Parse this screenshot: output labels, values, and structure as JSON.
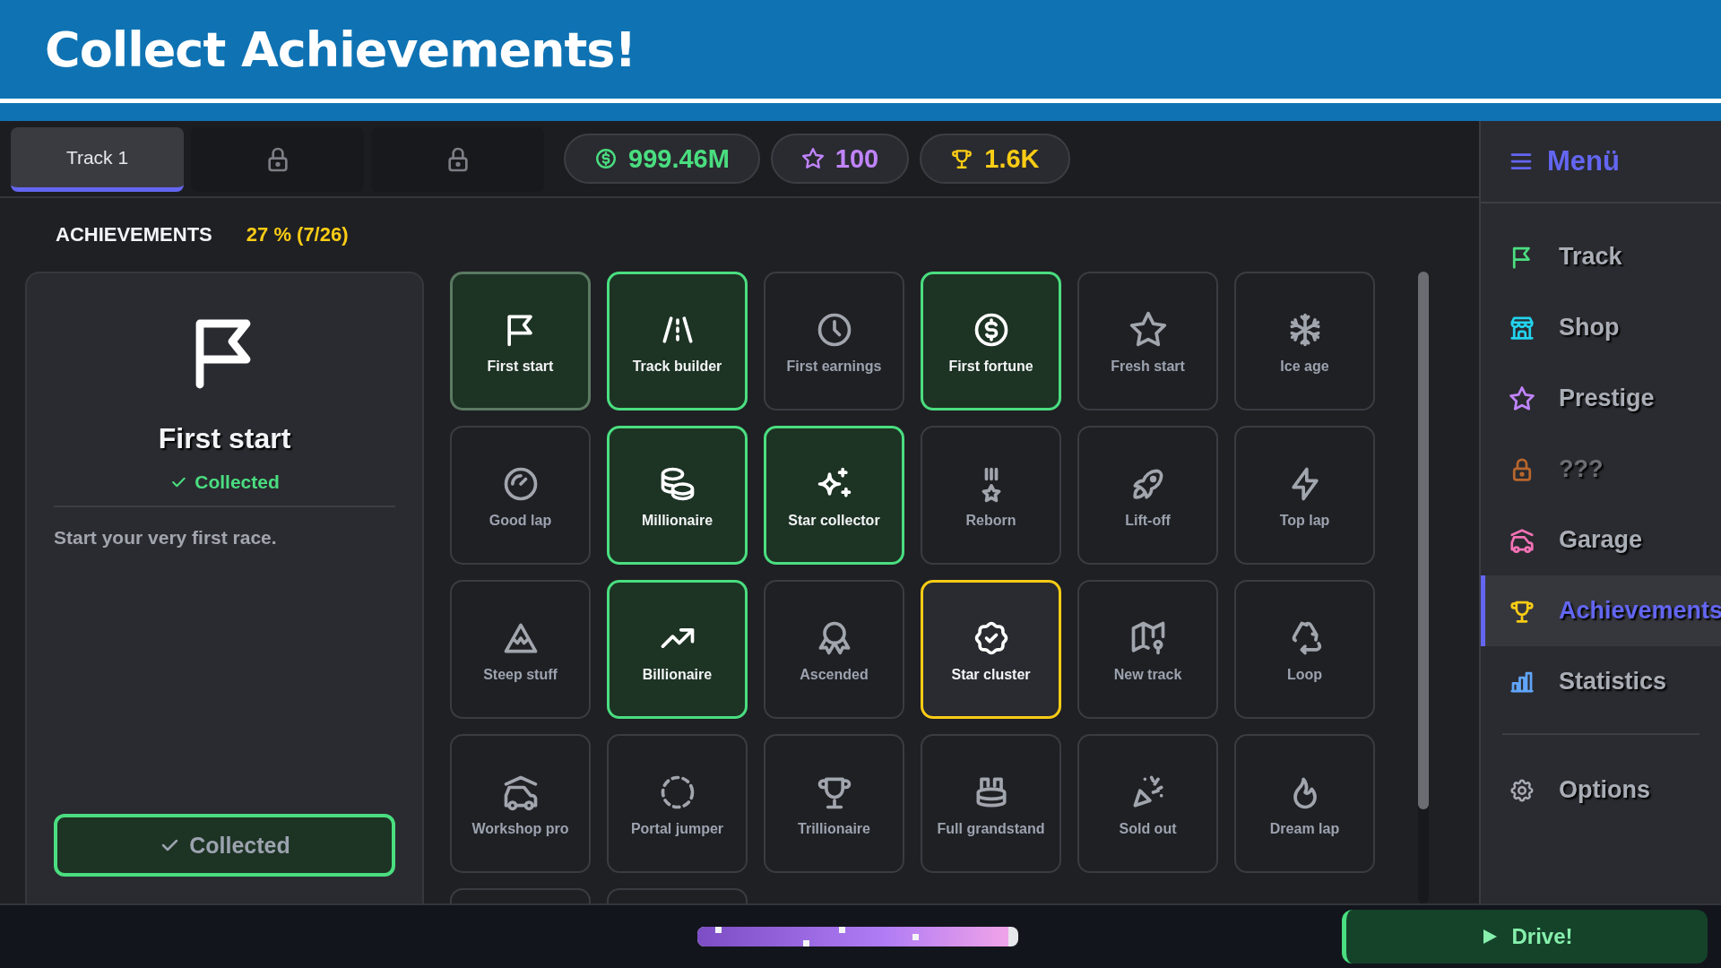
{
  "banner": {
    "title": "Collect Achievements!"
  },
  "tabs": [
    {
      "label": "Track 1",
      "selected": true,
      "locked": false
    },
    {
      "selected": false,
      "locked": true
    },
    {
      "selected": false,
      "locked": true
    }
  ],
  "currencies": [
    {
      "value": "999.46M",
      "color": "#4ade80"
    },
    {
      "value": "100",
      "color": "#c084fc"
    },
    {
      "value": "1.6K",
      "color": "#facc15"
    }
  ],
  "achievements": {
    "heading": "ACHIEVEMENTS",
    "progress": "27 % (7/26)",
    "detail": {
      "title": "First start",
      "status": "Collected",
      "description": "Start your very first race.",
      "button": "Collected",
      "collected": true
    },
    "items": [
      {
        "label": "First start",
        "collected": true,
        "claimable": false,
        "selected": true
      },
      {
        "label": "Track builder",
        "collected": true,
        "claimable": false,
        "selected": false
      },
      {
        "label": "First earnings",
        "collected": false,
        "claimable": false,
        "selected": false
      },
      {
        "label": "First fortune",
        "collected": true,
        "claimable": false,
        "selected": false
      },
      {
        "label": "Fresh start",
        "collected": false,
        "claimable": false,
        "selected": false
      },
      {
        "label": "Ice age",
        "collected": false,
        "claimable": false,
        "selected": false
      },
      {
        "label": "Good lap",
        "collected": false,
        "claimable": false,
        "selected": false
      },
      {
        "label": "Millionaire",
        "collected": true,
        "claimable": false,
        "selected": false
      },
      {
        "label": "Star collector",
        "collected": true,
        "claimable": false,
        "selected": false
      },
      {
        "label": "Reborn",
        "collected": false,
        "claimable": false,
        "selected": false
      },
      {
        "label": "Lift-off",
        "collected": false,
        "claimable": false,
        "selected": false
      },
      {
        "label": "Top lap",
        "collected": false,
        "claimable": false,
        "selected": false
      },
      {
        "label": "Steep stuff",
        "collected": false,
        "claimable": false,
        "selected": false
      },
      {
        "label": "Billionaire",
        "collected": true,
        "claimable": false,
        "selected": false
      },
      {
        "label": "Ascended",
        "collected": false,
        "claimable": false,
        "selected": false
      },
      {
        "label": "Star cluster",
        "collected": false,
        "claimable": true,
        "selected": false
      },
      {
        "label": "New track",
        "collected": false,
        "claimable": false,
        "selected": false
      },
      {
        "label": "Loop",
        "collected": false,
        "claimable": false,
        "selected": false
      },
      {
        "label": "Workshop pro",
        "collected": false,
        "claimable": false,
        "selected": false
      },
      {
        "label": "Portal jumper",
        "collected": false,
        "claimable": false,
        "selected": false
      },
      {
        "label": "Trillionaire",
        "collected": false,
        "claimable": false,
        "selected": false
      },
      {
        "label": "Full grandstand",
        "collected": false,
        "claimable": false,
        "selected": false
      },
      {
        "label": "Sold out",
        "collected": false,
        "claimable": false,
        "selected": false
      },
      {
        "label": "Dream lap",
        "collected": false,
        "claimable": false,
        "selected": false
      },
      {
        "collected": false,
        "claimable": false,
        "selected": false
      },
      {
        "collected": false,
        "claimable": false,
        "selected": false
      }
    ]
  },
  "sidebar": {
    "title": "Menü",
    "items": [
      {
        "label": "Track",
        "color": "#4ade80",
        "selected": false,
        "disabled": false
      },
      {
        "label": "Shop",
        "color": "#22d3ee",
        "selected": false,
        "disabled": false
      },
      {
        "label": "Prestige",
        "color": "#c084fc",
        "selected": false,
        "disabled": false
      },
      {
        "label": "???",
        "color": "#b8662c",
        "selected": false,
        "disabled": true
      },
      {
        "label": "Garage",
        "color": "#f472b6",
        "selected": false,
        "disabled": false
      },
      {
        "label": "Achievements",
        "color": "#facc15",
        "selected": true,
        "disabled": false
      },
      {
        "label": "Statistics",
        "color": "#60a5fa",
        "selected": false,
        "disabled": false
      }
    ],
    "footer_items": [
      {
        "label": "Options"
      }
    ]
  },
  "footer": {
    "race_progress": {
      "level": 0.97
    },
    "drive_button": "Drive!"
  }
}
